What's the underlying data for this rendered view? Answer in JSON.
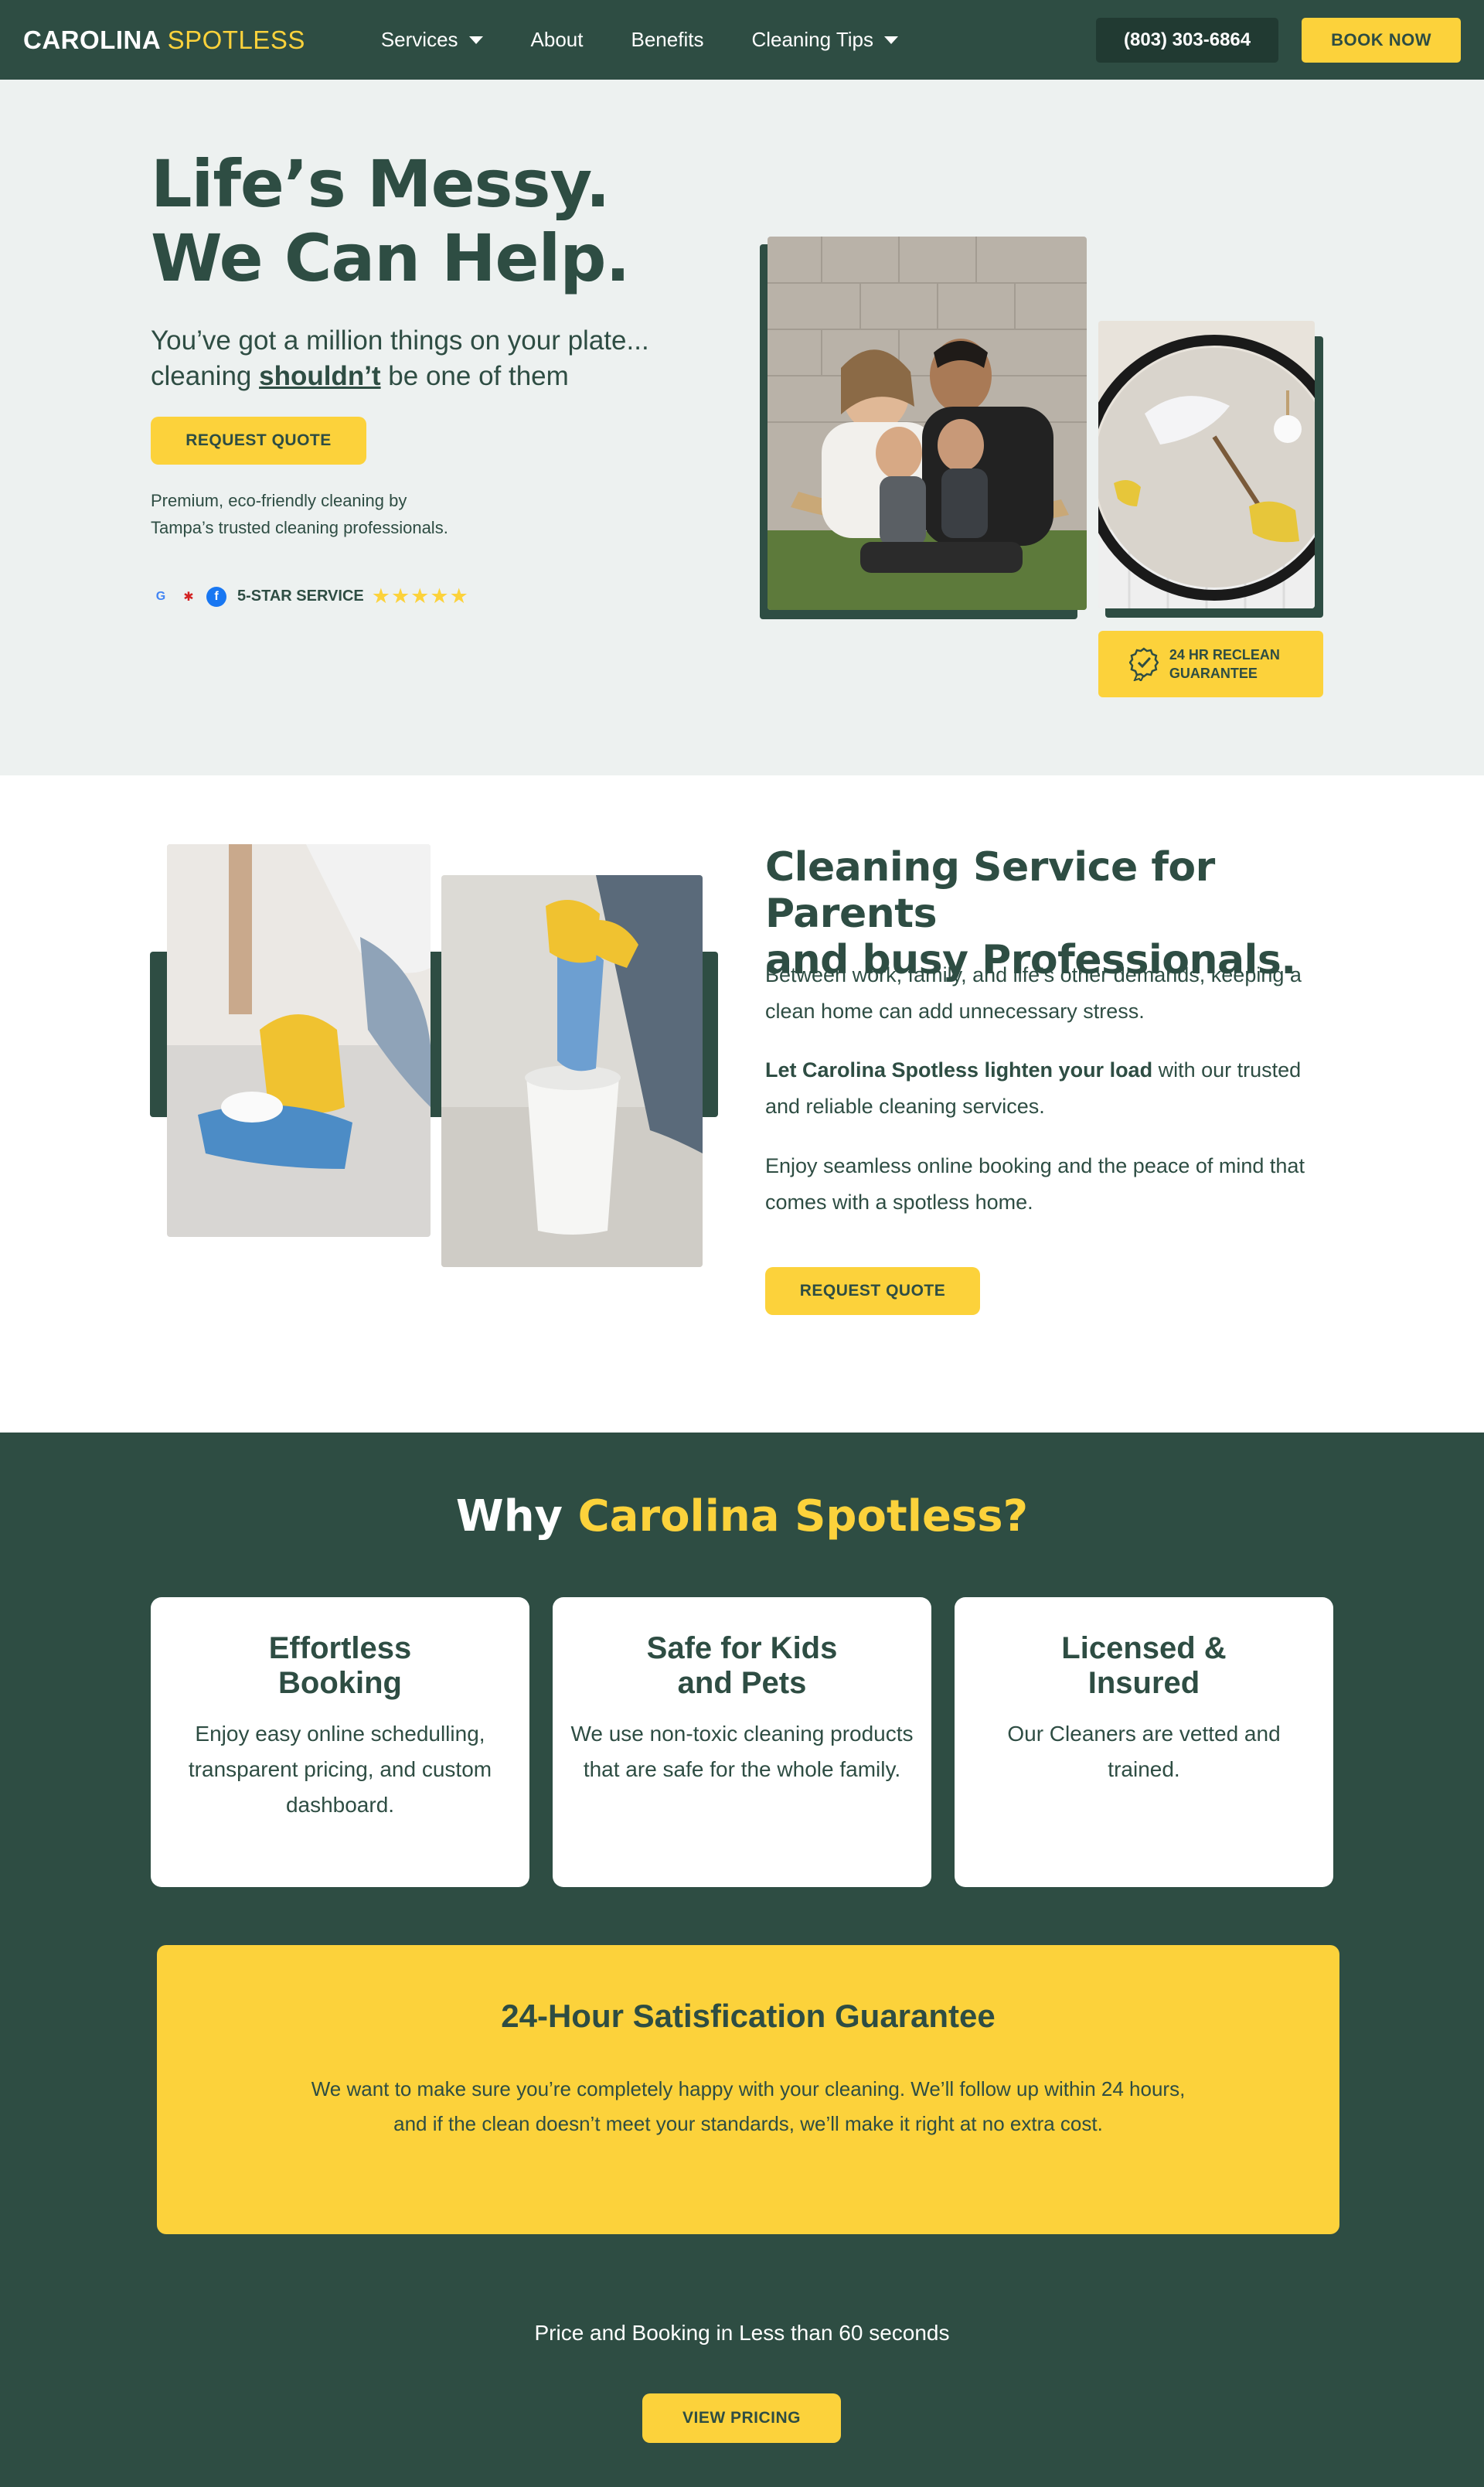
{
  "nav": {
    "logo_main": "CAROLINA ",
    "logo_accent": "SPOTLESS",
    "links": [
      {
        "label": "Services",
        "has_dropdown": true
      },
      {
        "label": "About",
        "has_dropdown": false
      },
      {
        "label": "Benefits",
        "has_dropdown": false
      },
      {
        "label": "Cleaning Tips",
        "has_dropdown": true
      }
    ],
    "phone": "(803) 303-6864",
    "book_label": "BOOK NOW"
  },
  "hero": {
    "title_line1": "Life’s Messy.",
    "title_line2": "We Can Help.",
    "sub_line1": "You’ve got a million things on your plate...",
    "sub_prefix": "cleaning ",
    "sub_strong": "shouldn’t",
    "sub_suffix": " be one of them",
    "cta": "REQUEST QUOTE",
    "desc_line1": "Premium, eco-friendly cleaning by",
    "desc_line2": "Tampa’s trusted cleaning professionals.",
    "rating_label": "5-STAR SERVICE",
    "stars": "★★★★★",
    "review_icons": [
      "google-icon",
      "yelp-icon",
      "facebook-icon"
    ],
    "guarantee_line1": "24 HR RECLEAN",
    "guarantee_line2": "GUARANTEE"
  },
  "section2": {
    "title_line1": "Cleaning Service for Parents",
    "title_line2": "and busy Professionals.",
    "p1": "Between work, family, and life’s other demands, keeping a clean home can add unnecessary stress.",
    "p2_strong": "Let Carolina Spotless lighten your load",
    "p2_rest": " with our trusted and reliable cleaning services.",
    "p3": "Enjoy seamless online booking and the peace of mind that comes with a spotless home.",
    "cta": "REQUEST QUOTE"
  },
  "why": {
    "title_prefix": "Why ",
    "title_accent": "Carolina Spotless?",
    "cards": [
      {
        "title_line1": "Effortless",
        "title_line2": "Booking",
        "body": "Enjoy easy online schedulling, transparent pricing, and custom dashboard."
      },
      {
        "title_line1": "Safe for Kids",
        "title_line2": "and Pets",
        "body": "We use non-toxic cleaning products that are safe for the whole family."
      },
      {
        "title_line1": "Licensed &",
        "title_line2": "Insured",
        "body": "Our Cleaners are vetted and trained."
      }
    ],
    "banner_title": "24-Hour Satisfication Guarantee",
    "banner_line1": "We want to make sure you’re completely happy with your cleaning. We’ll follow up within 24 hours,",
    "banner_line2": "and if the clean doesn’t meet your standards, we’ll make it right at no extra cost.",
    "pricing_text": "Price and Booking in Less than 60 seconds",
    "pricing_cta": "VIEW PRICING"
  },
  "colors": {
    "brand_green": "#2e4d43",
    "brand_yellow": "#fcd23b",
    "hero_bg": "#edf1f0"
  }
}
